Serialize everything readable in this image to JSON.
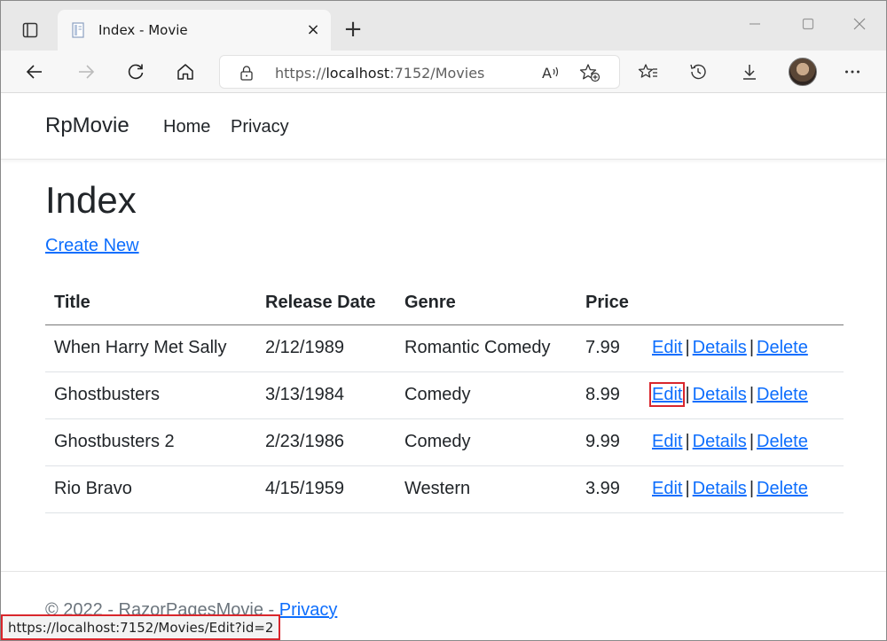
{
  "browser": {
    "tab_title": "Index - Movie",
    "tab_close": "×",
    "new_tab": "+",
    "url_prefix": "https://",
    "url_host": "localhost",
    "url_rest": ":7152/Movies",
    "status_url": "https://localhost:7152/Movies/Edit?id=2",
    "icons": [
      "tab-actions-icon",
      "favicon-icon",
      "close-icon",
      "plus-icon",
      "minimize-icon",
      "maximize-icon",
      "window-close-icon",
      "back-arrow-icon",
      "forward-arrow-icon",
      "refresh-icon",
      "home-icon",
      "lock-icon",
      "read-aloud-icon",
      "add-favorite-icon",
      "favorites-icon",
      "history-icon",
      "downloads-icon",
      "more-icon"
    ]
  },
  "site": {
    "brand": "RpMovie",
    "nav": {
      "home": "Home",
      "privacy": "Privacy"
    }
  },
  "page": {
    "title": "Index",
    "create_new": "Create New"
  },
  "table": {
    "headers": [
      "Title",
      "Release Date",
      "Genre",
      "Price"
    ],
    "actions": {
      "edit": "Edit",
      "details": "Details",
      "delete": "Delete",
      "separator": "|"
    },
    "rows": [
      {
        "title": "When Harry Met Sally",
        "release_date": "2/12/1989",
        "genre": "Romantic Comedy",
        "price": "7.99"
      },
      {
        "title": "Ghostbusters",
        "release_date": "3/13/1984",
        "genre": "Comedy",
        "price": "8.99"
      },
      {
        "title": "Ghostbusters 2",
        "release_date": "2/23/1986",
        "genre": "Comedy",
        "price": "9.99"
      },
      {
        "title": "Rio Bravo",
        "release_date": "4/15/1959",
        "genre": "Western",
        "price": "3.99"
      }
    ],
    "highlighted_row": 1
  },
  "footer": {
    "copyright": "© 2022 - RazorPagesMovie - ",
    "privacy": "Privacy"
  },
  "colors": {
    "link": "#0d6efd",
    "highlight": "#d9262c",
    "text": "#212529"
  }
}
